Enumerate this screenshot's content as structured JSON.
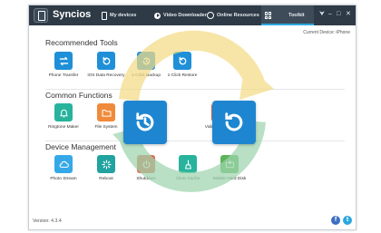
{
  "app": {
    "title": "Syncios"
  },
  "nav": {
    "my_devices": "My devices",
    "video_downloader": "Video Downloader",
    "online_resources": "Online Resources",
    "toolkit": "Toolkit"
  },
  "window_controls": [
    "⮟",
    "‒",
    "□",
    "✕"
  ],
  "current_device": "Current Device: iPhone",
  "sections": {
    "recommended": {
      "title": "Recommended Tools",
      "items": [
        "Phone Transfer",
        "iOS Data Recovery",
        "1-Click Backup",
        "1-Click Restore"
      ]
    },
    "common": {
      "title": "Common Functions",
      "items": [
        "Ringtone Maker",
        "File System",
        "Video Converter"
      ]
    },
    "device": {
      "title": "Device Management",
      "items": [
        "Photo Stream",
        "Reboot",
        "Shutdown",
        "Clear Cache",
        "Mobile Hard Disk"
      ]
    }
  },
  "footer": {
    "version": "Version: 4.3.4",
    "social": [
      "f",
      "t"
    ]
  },
  "colors": {
    "titlebar": "#2e3a46",
    "accent": "#1f8fd8",
    "tab_underline": "#2ba7e0",
    "overlay_arrow_yellow": "#f3dc86",
    "overlay_arrow_green": "#9fd5ae"
  },
  "icons": {
    "overlay_left": "backup-clock-icon",
    "overlay_right": "restore-icon"
  }
}
